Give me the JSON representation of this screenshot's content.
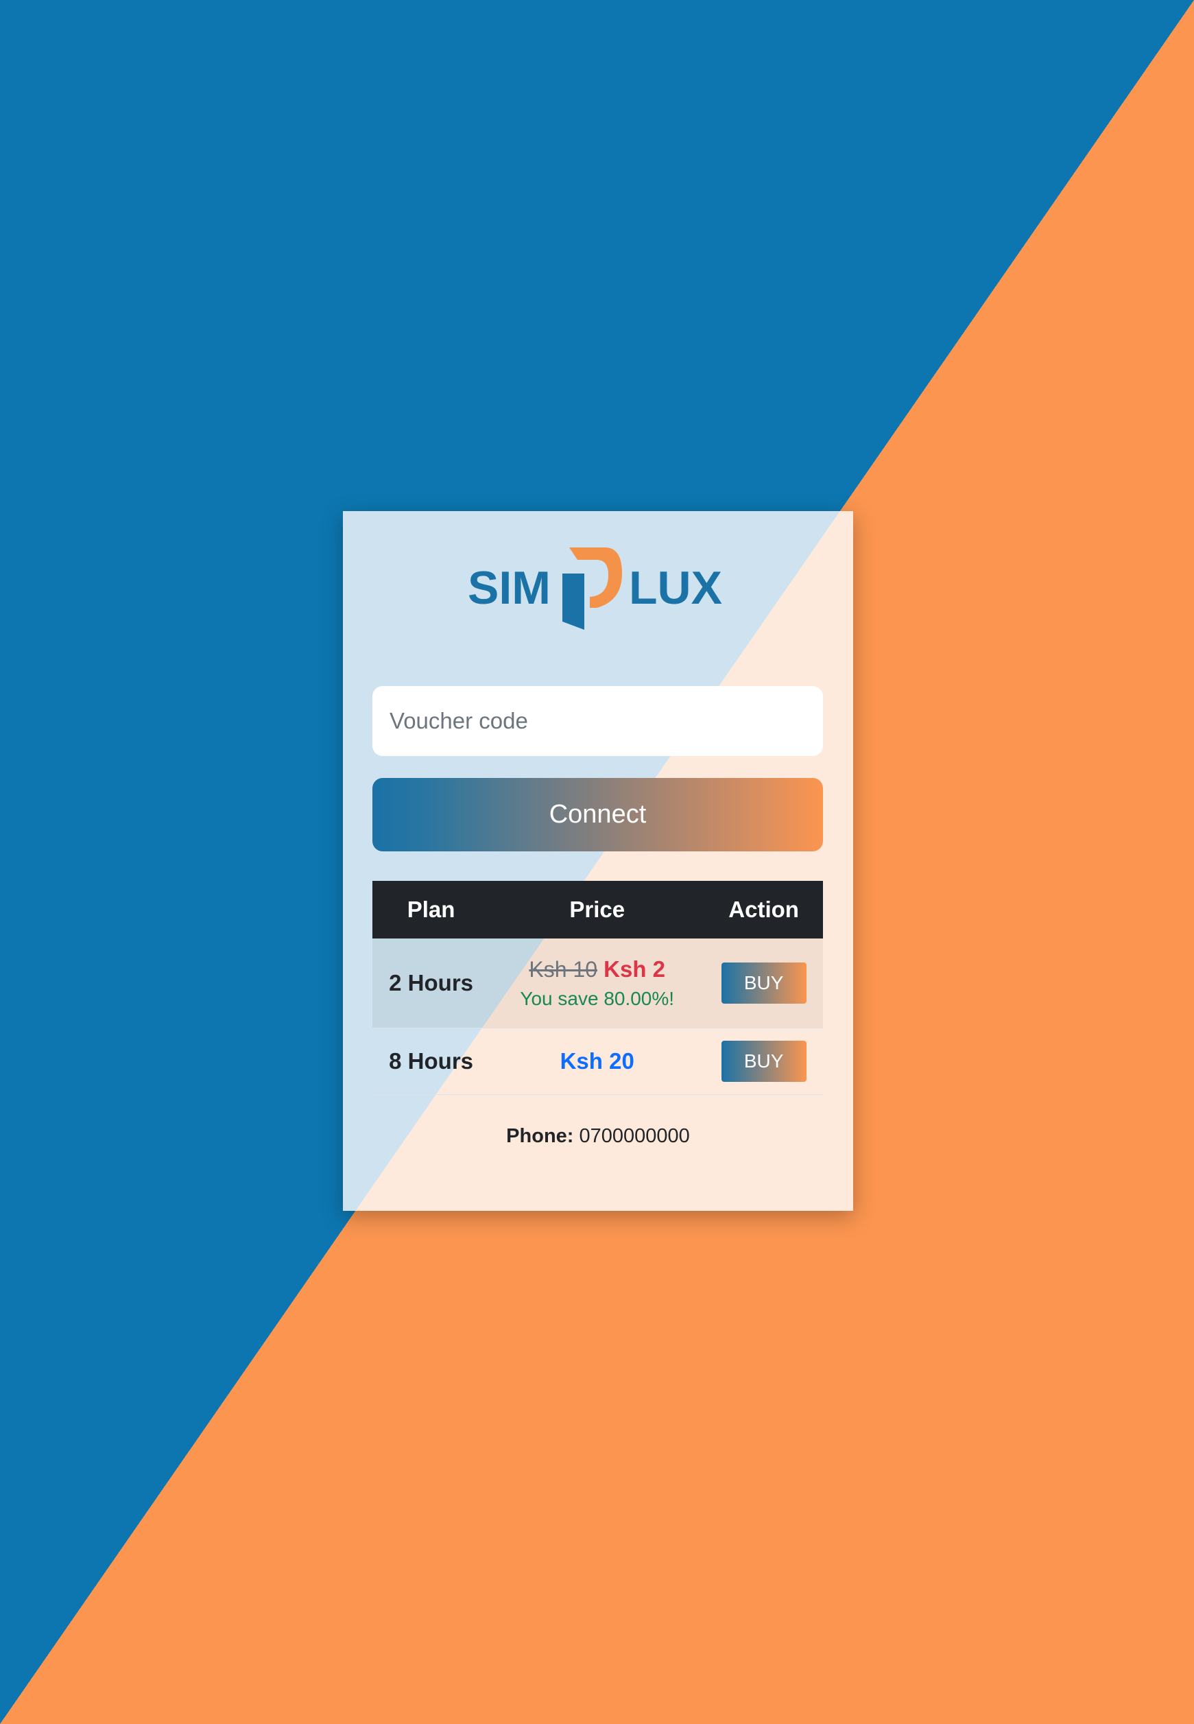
{
  "logo": {
    "text_left": "SIM",
    "text_right": "LUX"
  },
  "voucher": {
    "placeholder": "Voucher code",
    "value": ""
  },
  "connect_label": "Connect",
  "table": {
    "headers": [
      "Plan",
      "Price",
      "Action"
    ],
    "rows": [
      {
        "plan": "2 Hours",
        "old_price": "Ksh 10",
        "price": "Ksh 2",
        "savings": "You save 80.00%!",
        "action": "BUY"
      },
      {
        "plan": "8 Hours",
        "price": "Ksh 20",
        "action": "BUY"
      }
    ]
  },
  "contact": {
    "phone_label": "Phone:",
    "phone_value": "0700000000"
  },
  "colors": {
    "brand_blue": "#0d76b0",
    "brand_orange": "#fb9550",
    "header_dark": "#212529",
    "sale_red": "#dc3545",
    "save_green": "#198754",
    "price_blue": "#0d6efd"
  }
}
